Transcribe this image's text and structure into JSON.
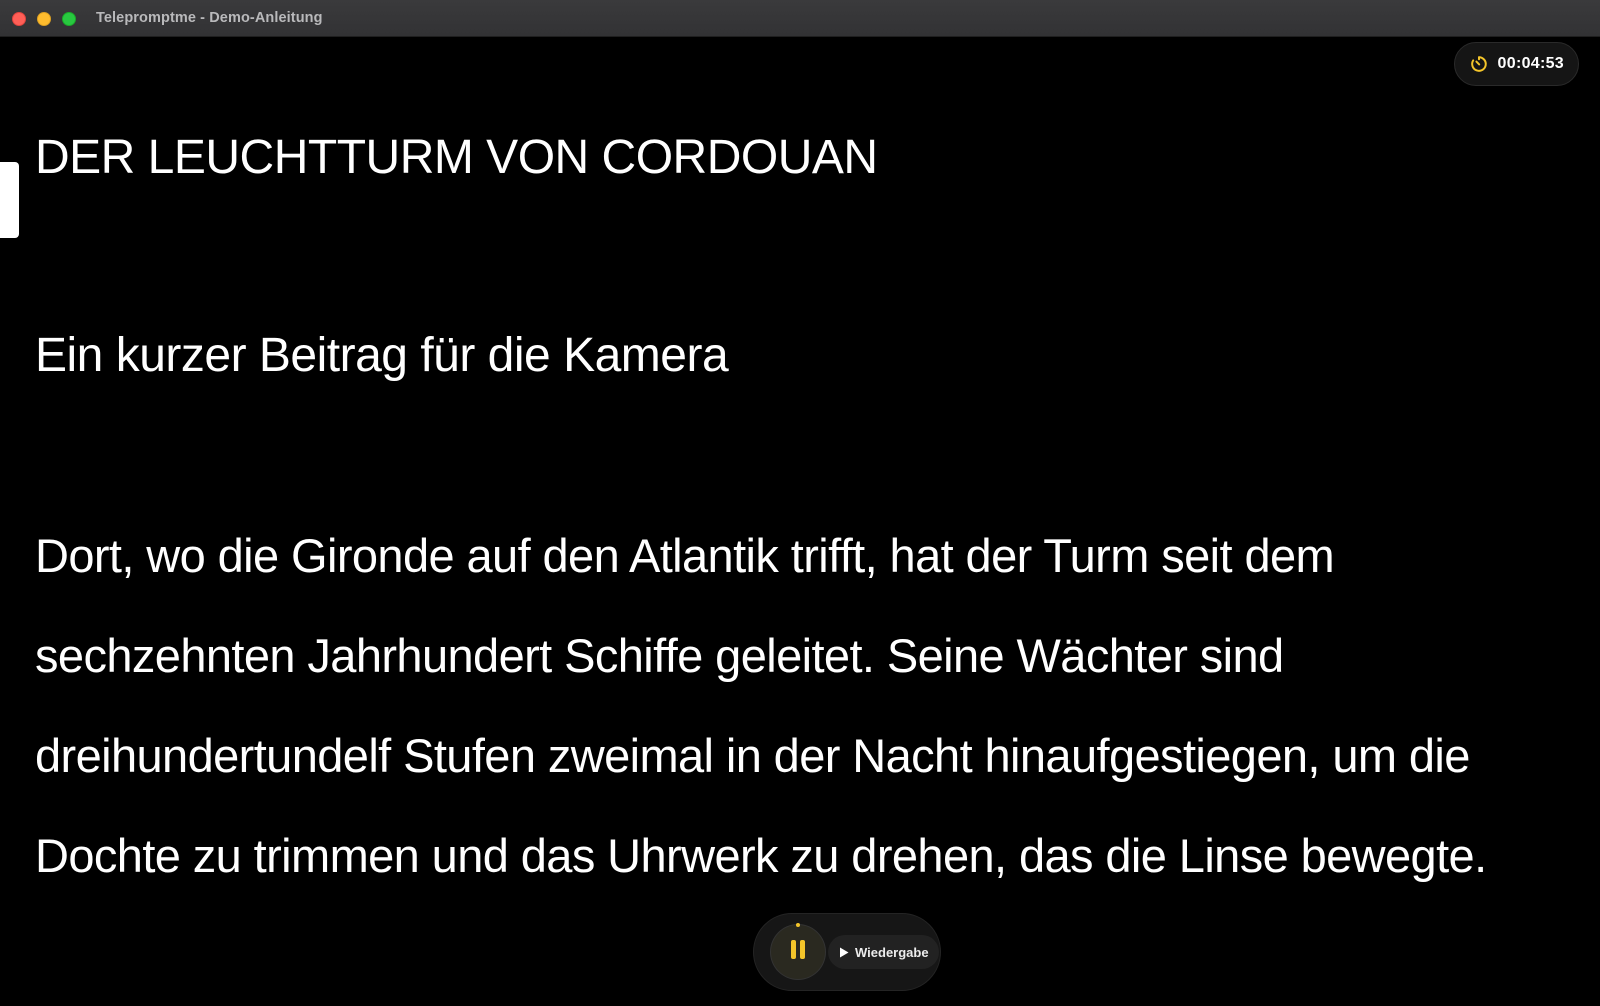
{
  "window": {
    "title": "Telepromptme - Demo-Anleitung"
  },
  "timer": {
    "icon": "timer-icon",
    "value": "00:04:53",
    "accent_color": "#f4c52a"
  },
  "script": {
    "title": "DER LEUCHTTURM VON CORDOUAN",
    "subtitle": "Ein kurzer Beitrag für die Kamera",
    "lines": [
      "Dort, wo die Gironde auf den Atlantik trifft, hat der Turm seit dem",
      "sechzehnten Jahrhundert Schiffe geleitet. Seine Wächter sind",
      "dreihundertundelf Stufen zweimal in der Nacht hinaufgestiegen, um die",
      "Dochte zu trimmen und das Uhrwerk zu drehen, das die Linse bewegte."
    ]
  },
  "controls": {
    "pause_icon": "pause-icon",
    "play_icon": "play-icon",
    "playback_label": "Wiedergabe",
    "accent_color": "#f4c52a"
  }
}
